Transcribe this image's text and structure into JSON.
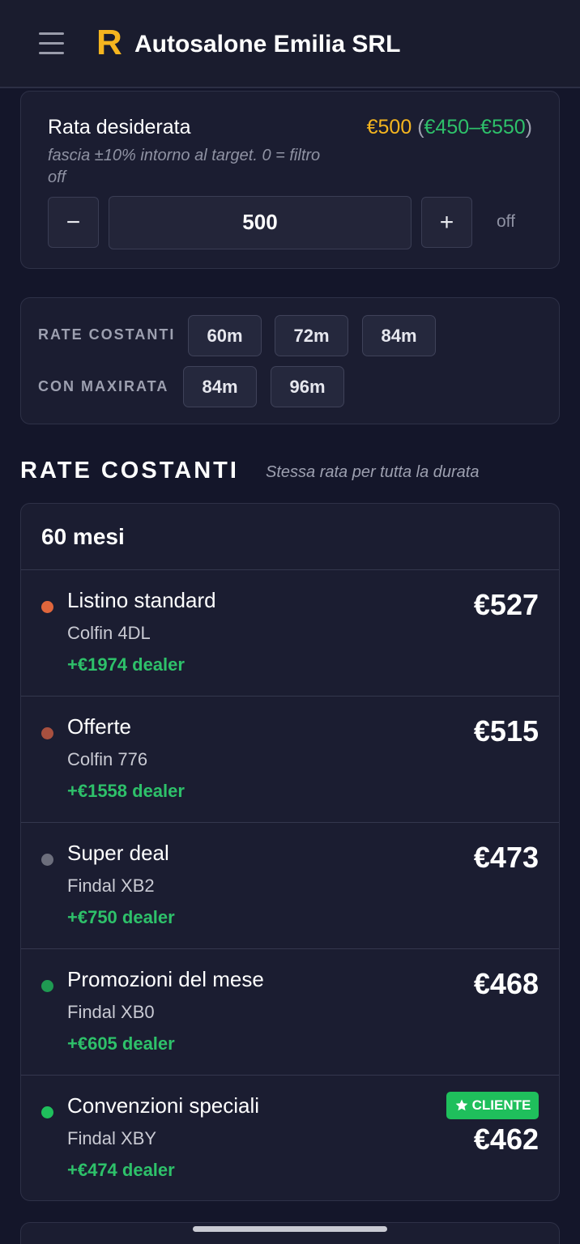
{
  "header": {
    "logo_letter": "R",
    "title": "Autosalone Emilia SRL"
  },
  "rata": {
    "label": "Rata desiderata",
    "target_display": "€500",
    "range_display": "€450–€550",
    "hint": "fascia ±10% intorno al target. 0 = filtro off",
    "input_value": "500",
    "minus_label": "−",
    "plus_label": "+",
    "off_label": "off"
  },
  "terms": {
    "costanti_label": "RATE COSTANTI",
    "costanti_options": [
      "60m",
      "72m",
      "84m"
    ],
    "maxirata_label": "CON MAXIRATA",
    "maxirata_options": [
      "84m",
      "96m"
    ]
  },
  "section": {
    "title": "RATE COSTANTI",
    "subtitle": "Stessa rata per tutta la durata"
  },
  "group": {
    "title": "60 mesi",
    "rows": [
      {
        "name": "Listino standard",
        "sub": "Colfin 4DL",
        "dealer": "+€1974 dealer",
        "price": "€527",
        "dot_color": "#e0663c"
      },
      {
        "name": "Offerte",
        "sub": "Colfin 776",
        "dealer": "+€1558 dealer",
        "price": "€515",
        "dot_color": "#a8503f"
      },
      {
        "name": "Super deal",
        "sub": "Findal XB2",
        "dealer": "+€750 dealer",
        "price": "€473",
        "dot_color": "#6c6e7c"
      },
      {
        "name": "Promozioni del mese",
        "sub": "Findal XB0",
        "dealer": "+€605 dealer",
        "price": "€468",
        "dot_color": "#1f9a52"
      },
      {
        "name": "Convenzioni speciali",
        "sub": "Findal XBY",
        "dealer": "+€474 dealer",
        "price": "€462",
        "dot_color": "#1fbf5c",
        "badge": "CLIENTE"
      }
    ]
  },
  "colors": {
    "accent_gold": "#f5b51f",
    "accent_green": "#2ec16a",
    "background": "#14162a"
  }
}
